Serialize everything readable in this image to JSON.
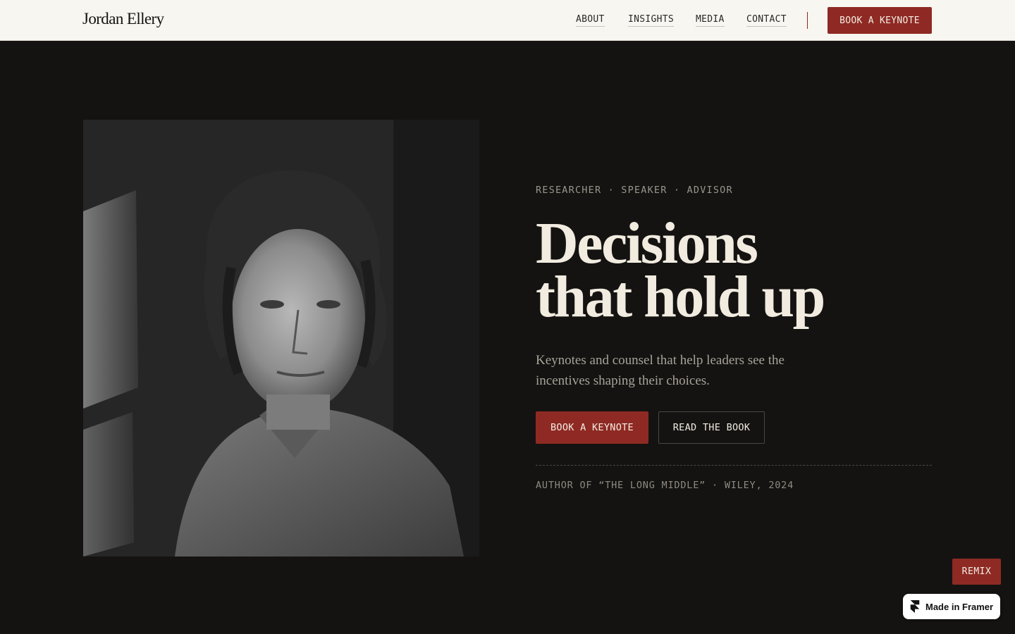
{
  "nav": {
    "logo": "Jordan Ellery",
    "links": [
      "ABOUT",
      "INSIGHTS",
      "MEDIA",
      "CONTACT"
    ],
    "cta": "BOOK A KEYNOTE"
  },
  "hero": {
    "eyebrow": "RESEARCHER · SPEAKER · ADVISOR",
    "headline_line1": "Decisions",
    "headline_line2": "that hold up",
    "lede": "Keynotes and counsel that help leaders see the incentives shaping their choices.",
    "primary_button": "BOOK A KEYNOTE",
    "secondary_button": "READ THE BOOK",
    "credit": "AUTHOR OF “THE LONG MIDDLE” · WILEY, 2024"
  },
  "overlay": {
    "remix_button": "REMIX",
    "badge_text": "Made in Framer",
    "badge_icon": "framer-logo-icon"
  },
  "colors": {
    "background": "#141311",
    "nav_background": "#f8f6f1",
    "accent": "#8e2a23",
    "headline": "#f1ebe0"
  }
}
